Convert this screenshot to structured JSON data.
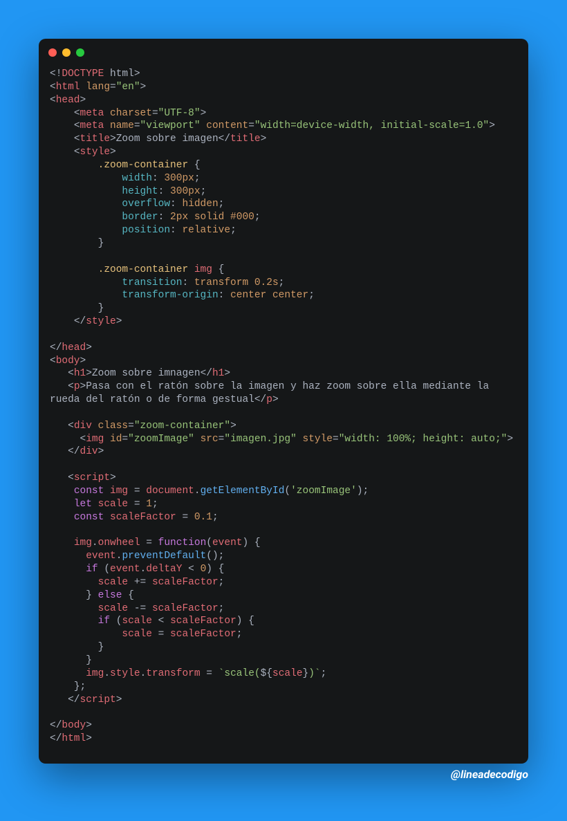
{
  "credit": "@lineadecodigo",
  "code": {
    "l1": {
      "a": "<!",
      "b": "DOCTYPE",
      "c": " html>"
    },
    "l2": {
      "a": "<",
      "b": "html",
      "c": " ",
      "d": "lang",
      "e": "=",
      "f": "\"en\"",
      "g": ">"
    },
    "l3": {
      "a": "<",
      "b": "head",
      "c": ">"
    },
    "l4": {
      "a": "    <",
      "b": "meta",
      "c": " ",
      "d": "charset",
      "e": "=",
      "f": "\"UTF-8\"",
      "g": ">"
    },
    "l5": {
      "a": "    <",
      "b": "meta",
      "c": " ",
      "d": "name",
      "e": "=",
      "f": "\"viewport\"",
      "g": " ",
      "h": "content",
      "i": "=",
      "j": "\"width=device-width, initial-scale=1.0\"",
      "k": ">"
    },
    "l6": {
      "a": "    <",
      "b": "title",
      "c": ">",
      "d": "Zoom sobre imagen",
      "e": "</",
      "f": "title",
      "g": ">"
    },
    "l7": {
      "a": "    <",
      "b": "style",
      "c": ">"
    },
    "l8": {
      "a": "        ",
      "b": ".zoom-container",
      "c": " {"
    },
    "l9": {
      "a": "            ",
      "b": "width",
      "c": ": ",
      "d": "300px",
      "e": ";"
    },
    "l10": {
      "a": "            ",
      "b": "height",
      "c": ": ",
      "d": "300px",
      "e": ";"
    },
    "l11": {
      "a": "            ",
      "b": "overflow",
      "c": ": ",
      "d": "hidden",
      "e": ";"
    },
    "l12": {
      "a": "            ",
      "b": "border",
      "c": ": ",
      "d": "2px solid #000",
      "e": ";"
    },
    "l13": {
      "a": "            ",
      "b": "position",
      "c": ": ",
      "d": "relative",
      "e": ";"
    },
    "l14": {
      "a": "        }"
    },
    "l15": "",
    "l16": {
      "a": "        ",
      "b": ".zoom-container",
      "c": " ",
      "d": "img",
      "e": " {"
    },
    "l17": {
      "a": "            ",
      "b": "transition",
      "c": ": ",
      "d": "transform 0.2s",
      "e": ";"
    },
    "l18": {
      "a": "            ",
      "b": "transform-origin",
      "c": ": ",
      "d": "center center",
      "e": ";"
    },
    "l19": {
      "a": "        }"
    },
    "l20": {
      "a": "    </",
      "b": "style",
      "c": ">"
    },
    "l21": "",
    "l22": {
      "a": "</",
      "b": "head",
      "c": ">"
    },
    "l23": {
      "a": "<",
      "b": "body",
      "c": ">"
    },
    "l24": {
      "a": "   <",
      "b": "h1",
      "c": ">",
      "d": "Zoom sobre imnagen",
      "e": "</",
      "f": "h1",
      "g": ">"
    },
    "l25": {
      "a": "   <",
      "b": "p",
      "c": ">",
      "d": "Pasa con el ratón sobre la imagen y haz zoom sobre ella mediante la rueda del ratón o de forma gestual",
      "e": "</",
      "f": "p",
      "g": ">"
    },
    "l26": "",
    "l27": {
      "a": "   <",
      "b": "div",
      "c": " ",
      "d": "class",
      "e": "=",
      "f": "\"zoom-container\"",
      "g": ">"
    },
    "l28": {
      "a": "     <",
      "b": "img",
      "c": " ",
      "d": "id",
      "e": "=",
      "f": "\"zoomImage\"",
      "g": " ",
      "h": "src",
      "i": "=",
      "j": "\"imagen.jpg\"",
      "k": " ",
      "l": "style",
      "m": "=",
      "n": "\"width: 100%; height: auto;\"",
      "o": ">"
    },
    "l29": {
      "a": "   </",
      "b": "div",
      "c": ">"
    },
    "l30": "",
    "l31": {
      "a": "   <",
      "b": "script",
      "c": ">"
    },
    "l32": {
      "a": "    ",
      "b": "const",
      "c": " ",
      "d": "img",
      "e": " = ",
      "f": "document",
      "g": ".",
      "h": "getElementById",
      "i": "(",
      "j": "'zoomImage'",
      "k": ");"
    },
    "l33": {
      "a": "    ",
      "b": "let",
      "c": " ",
      "d": "scale",
      "e": " = ",
      "f": "1",
      "g": ";"
    },
    "l34": {
      "a": "    ",
      "b": "const",
      "c": " ",
      "d": "scaleFactor",
      "e": " = ",
      "f": "0.1",
      "g": ";"
    },
    "l35": "",
    "l36": {
      "a": "    ",
      "b": "img",
      "c": ".",
      "d": "onwheel",
      "e": " = ",
      "f": "function",
      "g": "(",
      "h": "event",
      "i": ") {"
    },
    "l37": {
      "a": "      ",
      "b": "event",
      "c": ".",
      "d": "preventDefault",
      "e": "();"
    },
    "l38": {
      "a": "      ",
      "b": "if",
      "c": " (",
      "d": "event",
      "e": ".",
      "f": "deltaY",
      "g": " < ",
      "h": "0",
      "i": ") {"
    },
    "l39": {
      "a": "        ",
      "b": "scale",
      "c": " += ",
      "d": "scaleFactor",
      "e": ";"
    },
    "l40": {
      "a": "      } ",
      "b": "else",
      "c": " {"
    },
    "l41": {
      "a": "        ",
      "b": "scale",
      "c": " -= ",
      "d": "scaleFactor",
      "e": ";"
    },
    "l42": {
      "a": "        ",
      "b": "if",
      "c": " (",
      "d": "scale",
      "e": " < ",
      "f": "scaleFactor",
      "g": ") {"
    },
    "l43": {
      "a": "            ",
      "b": "scale",
      "c": " = ",
      "d": "scaleFactor",
      "e": ";"
    },
    "l44": {
      "a": "        }"
    },
    "l45": {
      "a": "      }"
    },
    "l46": {
      "a": "      ",
      "b": "img",
      "c": ".",
      "d": "style",
      "e": ".",
      "f": "transform",
      "g": " = ",
      "h": "`scale(",
      "i": "${",
      "j": "scale",
      "k": "}",
      "l": ")`",
      "m": ";"
    },
    "l47": {
      "a": "    };"
    },
    "l48": {
      "a": "   </",
      "b": "script",
      "c": ">"
    },
    "l49": "",
    "l50": {
      "a": "</",
      "b": "body",
      "c": ">"
    },
    "l51": {
      "a": "</",
      "b": "html",
      "c": ">"
    }
  }
}
